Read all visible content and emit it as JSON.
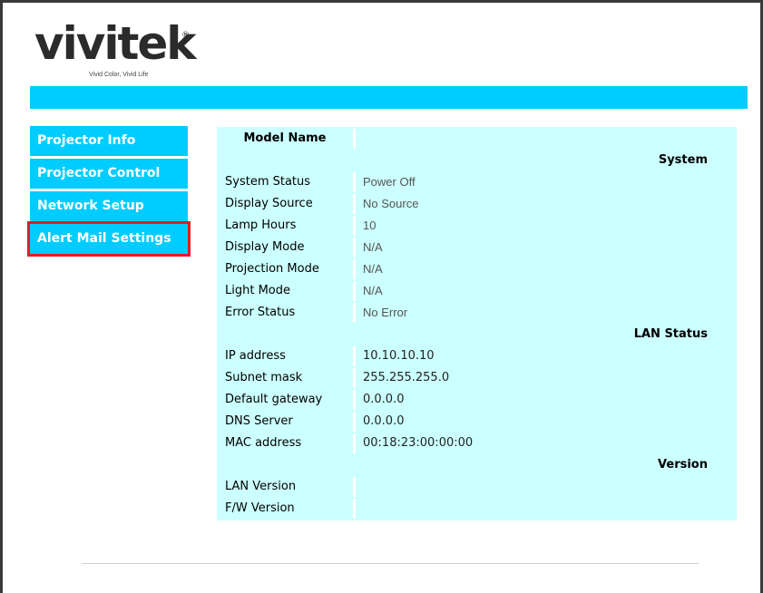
{
  "logo": {
    "word": "vivitek",
    "reg": "®",
    "tagline": "Vivid Color, Vivid Life"
  },
  "colors": {
    "accent": "#00ccff",
    "table_bg": "#ccffff",
    "highlight": "#e21b26"
  },
  "nav": {
    "items": [
      {
        "label": "Projector Info"
      },
      {
        "label": "Projector Control"
      },
      {
        "label": "Network Setup"
      },
      {
        "label": "Alert Mail Settings"
      }
    ]
  },
  "info": {
    "model_name_label": "Model Name",
    "model_name_value": "",
    "system_header": "System",
    "system_rows": [
      {
        "label": "System Status",
        "value": "Power Off"
      },
      {
        "label": "Display Source",
        "value": "No Source"
      },
      {
        "label": "Lamp Hours",
        "value": "10"
      },
      {
        "label": "Display Mode",
        "value": "N/A"
      },
      {
        "label": "Projection Mode",
        "value": "N/A"
      },
      {
        "label": "Light Mode",
        "value": "N/A"
      },
      {
        "label": "Error Status",
        "value": "No Error"
      }
    ],
    "lan_header": "LAN Status",
    "lan_rows": [
      {
        "label": "IP address",
        "value": "10.10.10.10"
      },
      {
        "label": "Subnet mask",
        "value": "255.255.255.0"
      },
      {
        "label": "Default gateway",
        "value": "0.0.0.0"
      },
      {
        "label": "DNS Server",
        "value": "0.0.0.0"
      },
      {
        "label": "MAC address",
        "value": "00:18:23:00:00:00"
      }
    ],
    "version_header": "Version",
    "version_rows": [
      {
        "label": "LAN Version",
        "value": ""
      },
      {
        "label": "F/W Version",
        "value": ""
      }
    ]
  }
}
